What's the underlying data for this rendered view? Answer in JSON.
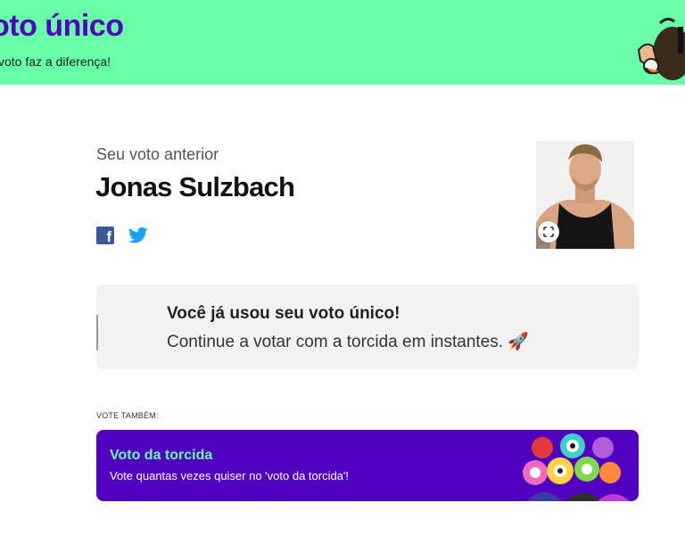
{
  "header": {
    "title": "oto único",
    "subtitle": "voto faz a diferença!",
    "background": "#69ffa6",
    "title_color": "#5200bf"
  },
  "previous_vote": {
    "label": "Seu voto anterior",
    "name": "Jonas Sulzbach",
    "share_icons": [
      "facebook-icon",
      "twitter-icon"
    ],
    "expand_icon": "expand-icon"
  },
  "notice": {
    "title": "Você já usou seu voto único!",
    "text": "Continue a votar com a torcida em instantes. 🚀"
  },
  "vote_also": {
    "label": "VOTE TAMBÉM:",
    "card_title": "Voto da torcida",
    "card_text": "Vote quantas vezes quiser no 'voto da torcida'!",
    "card_color": "#5200bf",
    "accent_color": "#69ffa6"
  }
}
